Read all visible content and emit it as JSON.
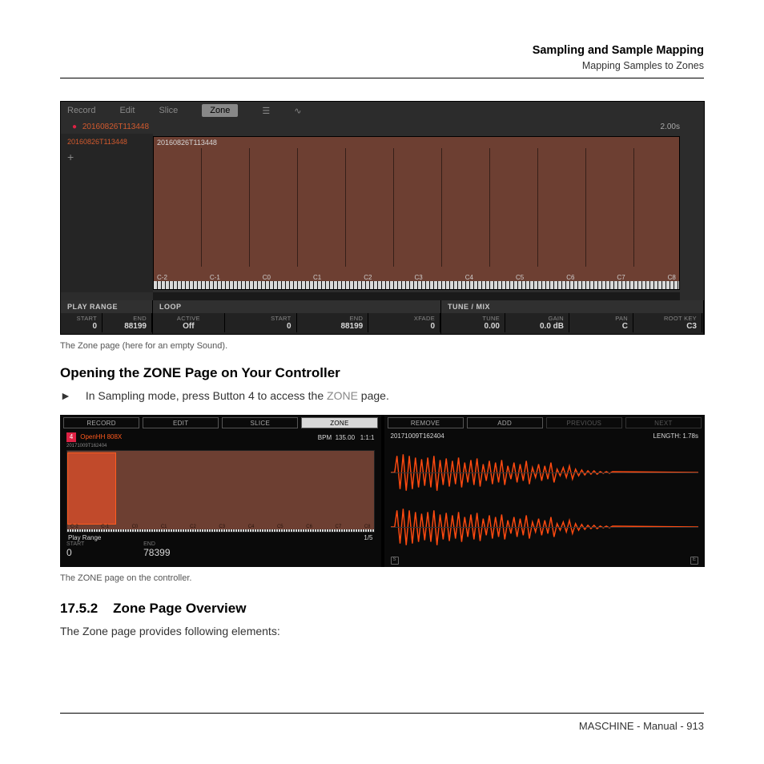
{
  "header": {
    "chapter": "Sampling and Sample Mapping",
    "section": "Mapping Samples to Zones"
  },
  "software": {
    "tabs": {
      "record": "Record",
      "edit": "Edit",
      "slice": "Slice",
      "zone": "Zone"
    },
    "sample_id": "20160826T113448",
    "side_name": "20160826T113448",
    "duration": "2.00s",
    "map_label": "20160826T113448",
    "notes": [
      "C-2",
      "C-1",
      "C0",
      "C1",
      "C2",
      "C3",
      "C4",
      "C5",
      "C6",
      "C7",
      "C8"
    ],
    "play_range": {
      "title": "PLAY RANGE",
      "start_lbl": "START",
      "start": "0",
      "end_lbl": "END",
      "end": "88199"
    },
    "loop": {
      "title": "LOOP",
      "active_lbl": "ACTIVE",
      "active": "Off",
      "start_lbl": "START",
      "start": "0",
      "end_lbl": "END",
      "end": "88199",
      "xfade_lbl": "XFADE",
      "xfade": "0"
    },
    "tunemix": {
      "title": "TUNE / MIX",
      "tune_lbl": "TUNE",
      "tune": "0.00",
      "gain_lbl": "GAIN",
      "gain": "0.0 dB",
      "pan_lbl": "PAN",
      "pan": "C",
      "root_lbl": "ROOT KEY",
      "root": "C3"
    }
  },
  "caption1": "The Zone page (here for an empty Sound).",
  "h3": "Opening the ZONE Page on Your Controller",
  "step1": {
    "arrow": "►",
    "pre": "In Sampling mode, press Button 4 to access the ",
    "link": "ZONE",
    "post": " page."
  },
  "controller": {
    "left": {
      "tabs": {
        "record": "RECORD",
        "edit": "EDIT",
        "slice": "SLICE",
        "zone": "ZONE"
      },
      "pad_num": "4",
      "name": "OpenHH 808X",
      "bpm_lbl": "BPM",
      "bpm": "135.00",
      "bars": "1:1:1",
      "timestamp": "20171009T162404",
      "notes": [
        "C-2",
        "C-1",
        "C0",
        "C1",
        "C2",
        "C3",
        "C4",
        "C5",
        "C6",
        "C7",
        "C8"
      ],
      "range_title": "Play Range",
      "range_page": "1/5",
      "start_lbl": "START",
      "start": "0",
      "end_lbl": "END",
      "end": "78399"
    },
    "right": {
      "tabs": {
        "remove": "REMOVE",
        "add": "ADD",
        "prev": "PREVIOUS",
        "next": "NEXT"
      },
      "timestamp": "20171009T162404",
      "length": "LENGTH: 1.78s",
      "ep_s": "S",
      "ep_e": "E"
    }
  },
  "caption2": "The ZONE page on the controller.",
  "section": {
    "num": "17.5.2",
    "title": "Zone Page Overview",
    "text": "The Zone page provides following elements:"
  },
  "footer": {
    "product": "MASCHINE - Manual - ",
    "page": "913"
  }
}
